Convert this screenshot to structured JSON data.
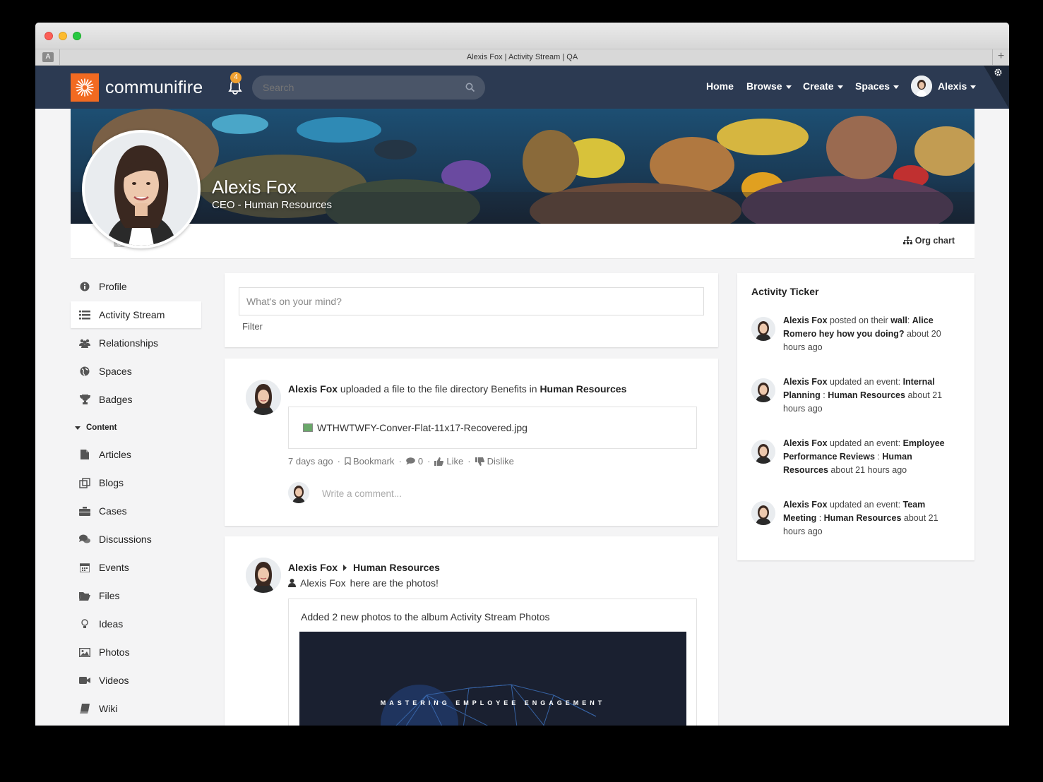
{
  "window": {
    "tab_title": "Alexis Fox | Activity Stream | QA",
    "tab_icon_letter": "A"
  },
  "header": {
    "logo_text": "communifire",
    "notification_count": "4",
    "search_placeholder": "Search",
    "nav": {
      "home": "Home",
      "browse": "Browse",
      "create": "Create",
      "spaces": "Spaces",
      "user": "Alexis"
    }
  },
  "profile": {
    "name": "Alexis Fox",
    "title": "CEO - Human Resources",
    "org_chart": "Org chart"
  },
  "sidebar": {
    "items": [
      {
        "label": "Profile",
        "icon": "info-icon"
      },
      {
        "label": "Activity Stream",
        "icon": "list-icon"
      },
      {
        "label": "Relationships",
        "icon": "users-icon"
      },
      {
        "label": "Spaces",
        "icon": "globe-icon"
      },
      {
        "label": "Badges",
        "icon": "trophy-icon"
      }
    ],
    "content_group": "Content",
    "content_items": [
      {
        "label": "Articles",
        "icon": "file-icon"
      },
      {
        "label": "Blogs",
        "icon": "blog-icon"
      },
      {
        "label": "Cases",
        "icon": "briefcase-icon"
      },
      {
        "label": "Discussions",
        "icon": "comments-icon"
      },
      {
        "label": "Events",
        "icon": "calendar-icon"
      },
      {
        "label": "Files",
        "icon": "folder-icon"
      },
      {
        "label": "Ideas",
        "icon": "lightbulb-icon"
      },
      {
        "label": "Photos",
        "icon": "image-icon"
      },
      {
        "label": "Videos",
        "icon": "video-icon"
      },
      {
        "label": "Wiki",
        "icon": "book-icon"
      }
    ]
  },
  "composer": {
    "placeholder": "What's on your mind?",
    "filter": "Filter"
  },
  "post1": {
    "author": "Alexis Fox",
    "action": " uploaded a file to the file directory Benefits in ",
    "target": "Human Resources",
    "file_name": "WTHWTWFY-Conver-Flat-11x17-Recovered.jpg",
    "time": "7 days ago",
    "bookmark": "Bookmark",
    "comments": "0",
    "like": "Like",
    "dislike": "Dislike",
    "comment_placeholder": "Write a comment..."
  },
  "post2": {
    "author": "Alexis Fox",
    "space": "Human Resources",
    "sub_author": "Alexis Fox",
    "message": "here are the photos!",
    "album_text": "Added 2 new photos to the album Activity Stream Photos",
    "image_caption": "MASTERING EMPLOYEE ENGAGEMENT"
  },
  "ticker": {
    "title": "Activity Ticker",
    "items": [
      {
        "author": "Alexis Fox",
        "mid": " posted on their ",
        "b1": "wall",
        "sep": ": ",
        "b2": "Alice Romero hey how you doing?",
        "time": " about 20 hours ago"
      },
      {
        "author": "Alexis Fox",
        "mid": " updated an event: ",
        "b1": "Internal Planning",
        "sep": " : ",
        "b2": "Human Resources",
        "time": " about 21 hours ago"
      },
      {
        "author": "Alexis Fox",
        "mid": " updated an event: ",
        "b1": "Employee Performance Reviews",
        "sep": " : ",
        "b2": "Human Resources",
        "time": " about 21 hours ago"
      },
      {
        "author": "Alexis Fox",
        "mid": " updated an event: ",
        "b1": "Team Meeting",
        "sep": " : ",
        "b2": "Human Resources",
        "time": " about 21 hours ago"
      }
    ]
  },
  "colors": {
    "nav_bg": "#2c3a52",
    "brand_orange": "#f26a21",
    "badge": "#f0a030"
  }
}
